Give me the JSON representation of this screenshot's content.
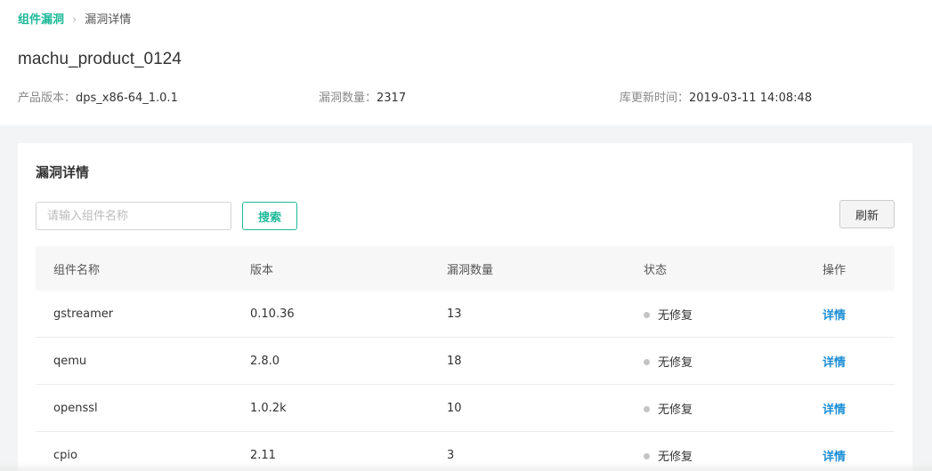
{
  "breadcrumb": {
    "parent": "组件漏洞",
    "separator": "›",
    "current": "漏洞详情"
  },
  "product": {
    "title": "machu_product_0124",
    "version_label": "产品版本：",
    "version_value": "dps_x86-64_1.0.1",
    "vuln_count_label": "漏洞数量：",
    "vuln_count_value": "2317",
    "updated_label": "库更新时间：",
    "updated_value": "2019-03-11 14:08:48"
  },
  "panel": {
    "title": "漏洞详情",
    "search_placeholder": "请输入组件名称",
    "search_button": "搜索",
    "refresh_button": "刷新"
  },
  "table": {
    "headers": [
      "组件名称",
      "版本",
      "漏洞数量",
      "状态",
      "操作"
    ],
    "rows": [
      {
        "name": "gstreamer",
        "version": "0.10.36",
        "count": "13",
        "status": "无修复",
        "action": "详情"
      },
      {
        "name": "qemu",
        "version": "2.8.0",
        "count": "18",
        "status": "无修复",
        "action": "详情"
      },
      {
        "name": "openssl",
        "version": "1.0.2k",
        "count": "10",
        "status": "无修复",
        "action": "详情"
      },
      {
        "name": "cpio",
        "version": "2.11",
        "count": "3",
        "status": "无修复",
        "action": "详情"
      }
    ]
  },
  "colors": {
    "accent": "#1fba9a",
    "link": "#1c8ed6",
    "status_dot": "#c4c4c4"
  }
}
